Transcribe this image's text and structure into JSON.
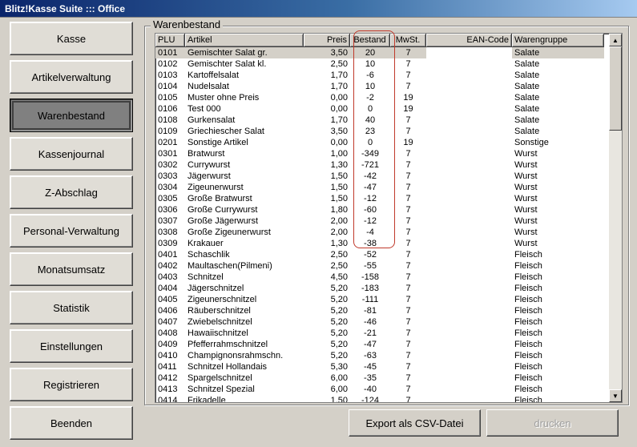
{
  "window": {
    "title": "Blitz!Kasse Suite ::: Office"
  },
  "sidebar": {
    "items": [
      {
        "label": "Kasse",
        "active": false
      },
      {
        "label": "Artikelverwaltung",
        "active": false
      },
      {
        "label": "Warenbestand",
        "active": true
      },
      {
        "label": "Kassenjournal",
        "active": false
      },
      {
        "label": "Z-Abschlag",
        "active": false
      },
      {
        "label": "Personal-Verwaltung",
        "active": false
      },
      {
        "label": "Monatsumsatz",
        "active": false
      },
      {
        "label": "Statistik",
        "active": false
      },
      {
        "label": "Einstellungen",
        "active": false
      },
      {
        "label": "Registrieren",
        "active": false
      },
      {
        "label": "Beenden",
        "active": false
      }
    ]
  },
  "panel": {
    "title": "Warenbestand",
    "columns": [
      "PLU",
      "Artikel",
      "Preis",
      "Bestand",
      "MwSt.",
      "EAN-Code",
      "Warengruppe"
    ],
    "rows": [
      [
        "0101",
        "Gemischter Salat gr.",
        "3,50",
        "20",
        "7",
        "",
        "Salate"
      ],
      [
        "0102",
        "Gemischter Salat kl.",
        "2,50",
        "10",
        "7",
        "",
        "Salate"
      ],
      [
        "0103",
        "Kartoffelsalat",
        "1,70",
        "-6",
        "7",
        "",
        "Salate"
      ],
      [
        "0104",
        "Nudelsalat",
        "1,70",
        "10",
        "7",
        "",
        "Salate"
      ],
      [
        "0105",
        "Muster ohne Preis",
        "0,00",
        "-2",
        "19",
        "",
        "Salate"
      ],
      [
        "0106",
        "Test 000",
        "0,00",
        "0",
        "19",
        "",
        "Salate"
      ],
      [
        "0108",
        "Gurkensalat",
        "1,70",
        "40",
        "7",
        "",
        "Salate"
      ],
      [
        "0109",
        "Griechiescher Salat",
        "3,50",
        "23",
        "7",
        "",
        "Salate"
      ],
      [
        "0201",
        "Sonstige Artikel",
        "0,00",
        "0",
        "19",
        "",
        "Sonstige"
      ],
      [
        "0301",
        "Bratwurst",
        "1,00",
        "-349",
        "7",
        "",
        "Wurst"
      ],
      [
        "0302",
        "Currywurst",
        "1,30",
        "-721",
        "7",
        "",
        "Wurst"
      ],
      [
        "0303",
        "Jägerwurst",
        "1,50",
        "-42",
        "7",
        "",
        "Wurst"
      ],
      [
        "0304",
        "Zigeunerwurst",
        "1,50",
        "-47",
        "7",
        "",
        "Wurst"
      ],
      [
        "0305",
        "Große Bratwurst",
        "1,50",
        "-12",
        "7",
        "",
        "Wurst"
      ],
      [
        "0306",
        "Große Currywurst",
        "1,80",
        "-60",
        "7",
        "",
        "Wurst"
      ],
      [
        "0307",
        "Große Jägerwurst",
        "2,00",
        "-12",
        "7",
        "",
        "Wurst"
      ],
      [
        "0308",
        "Große Zigeunerwurst",
        "2,00",
        "-4",
        "7",
        "",
        "Wurst"
      ],
      [
        "0309",
        "Krakauer",
        "1,30",
        "-38",
        "7",
        "",
        "Wurst"
      ],
      [
        "0401",
        "Schaschlik",
        "2,50",
        "-52",
        "7",
        "",
        "Fleisch"
      ],
      [
        "0402",
        "Maultaschen(Pilmeni)",
        "2,50",
        "-55",
        "7",
        "",
        "Fleisch"
      ],
      [
        "0403",
        "Schnitzel",
        "4,50",
        "-158",
        "7",
        "",
        "Fleisch"
      ],
      [
        "0404",
        "Jägerschnitzel",
        "5,20",
        "-183",
        "7",
        "",
        "Fleisch"
      ],
      [
        "0405",
        "Zigeunerschnitzel",
        "5,20",
        "-111",
        "7",
        "",
        "Fleisch"
      ],
      [
        "0406",
        "Räuberschnitzel",
        "5,20",
        "-81",
        "7",
        "",
        "Fleisch"
      ],
      [
        "0407",
        "Zwiebelschnitzel",
        "5,20",
        "-46",
        "7",
        "",
        "Fleisch"
      ],
      [
        "0408",
        "Hawaiischnitzel",
        "5,20",
        "-21",
        "7",
        "",
        "Fleisch"
      ],
      [
        "0409",
        "Pfefferrahmschnitzel",
        "5,20",
        "-47",
        "7",
        "",
        "Fleisch"
      ],
      [
        "0410",
        "Champignonsrahmschn.",
        "5,20",
        "-63",
        "7",
        "",
        "Fleisch"
      ],
      [
        "0411",
        "Schnitzel Hollandais",
        "5,30",
        "-45",
        "7",
        "",
        "Fleisch"
      ],
      [
        "0412",
        "Spargelschnitzel",
        "6,00",
        "-35",
        "7",
        "",
        "Fleisch"
      ],
      [
        "0413",
        "Schnitzel Spezial",
        "6,00",
        "-40",
        "7",
        "",
        "Fleisch"
      ],
      [
        "0414",
        "Frikadelle",
        "1,50",
        "-124",
        "7",
        "",
        "Fleisch"
      ]
    ]
  },
  "buttons": {
    "export_label": "Export als CSV-Datei",
    "print_label": "drucken"
  },
  "colors": {
    "title_bar": "#0a246a",
    "highlight_border": "#c0392b",
    "face": "#d4d0c8"
  },
  "icons": {
    "scroll_up": "scroll-up-arrow-icon",
    "scroll_down": "scroll-down-arrow-icon"
  }
}
